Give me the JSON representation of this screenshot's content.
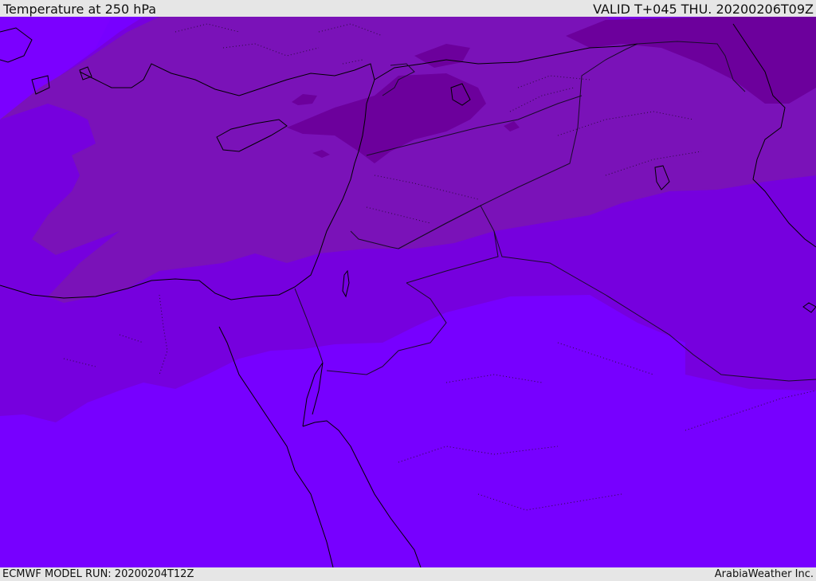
{
  "header": {
    "title": "Temperature at 250 hPa",
    "valid_time": "VALID T+045 THU. 20200206T09Z"
  },
  "footer": {
    "model_run": "ECMWF MODEL RUN: 20200204T12Z",
    "credit": "ArabiaWeather Inc."
  },
  "map": {
    "field_colors": {
      "coldest": "#6c009c",
      "cold": "#7a12b8",
      "mid": "#7600de",
      "warm": "#7700ff",
      "edge": "#7b00ff"
    },
    "line_colors": {
      "coast": "#000000",
      "border": "#1a0a2a",
      "province": "#2a0a3c"
    }
  }
}
